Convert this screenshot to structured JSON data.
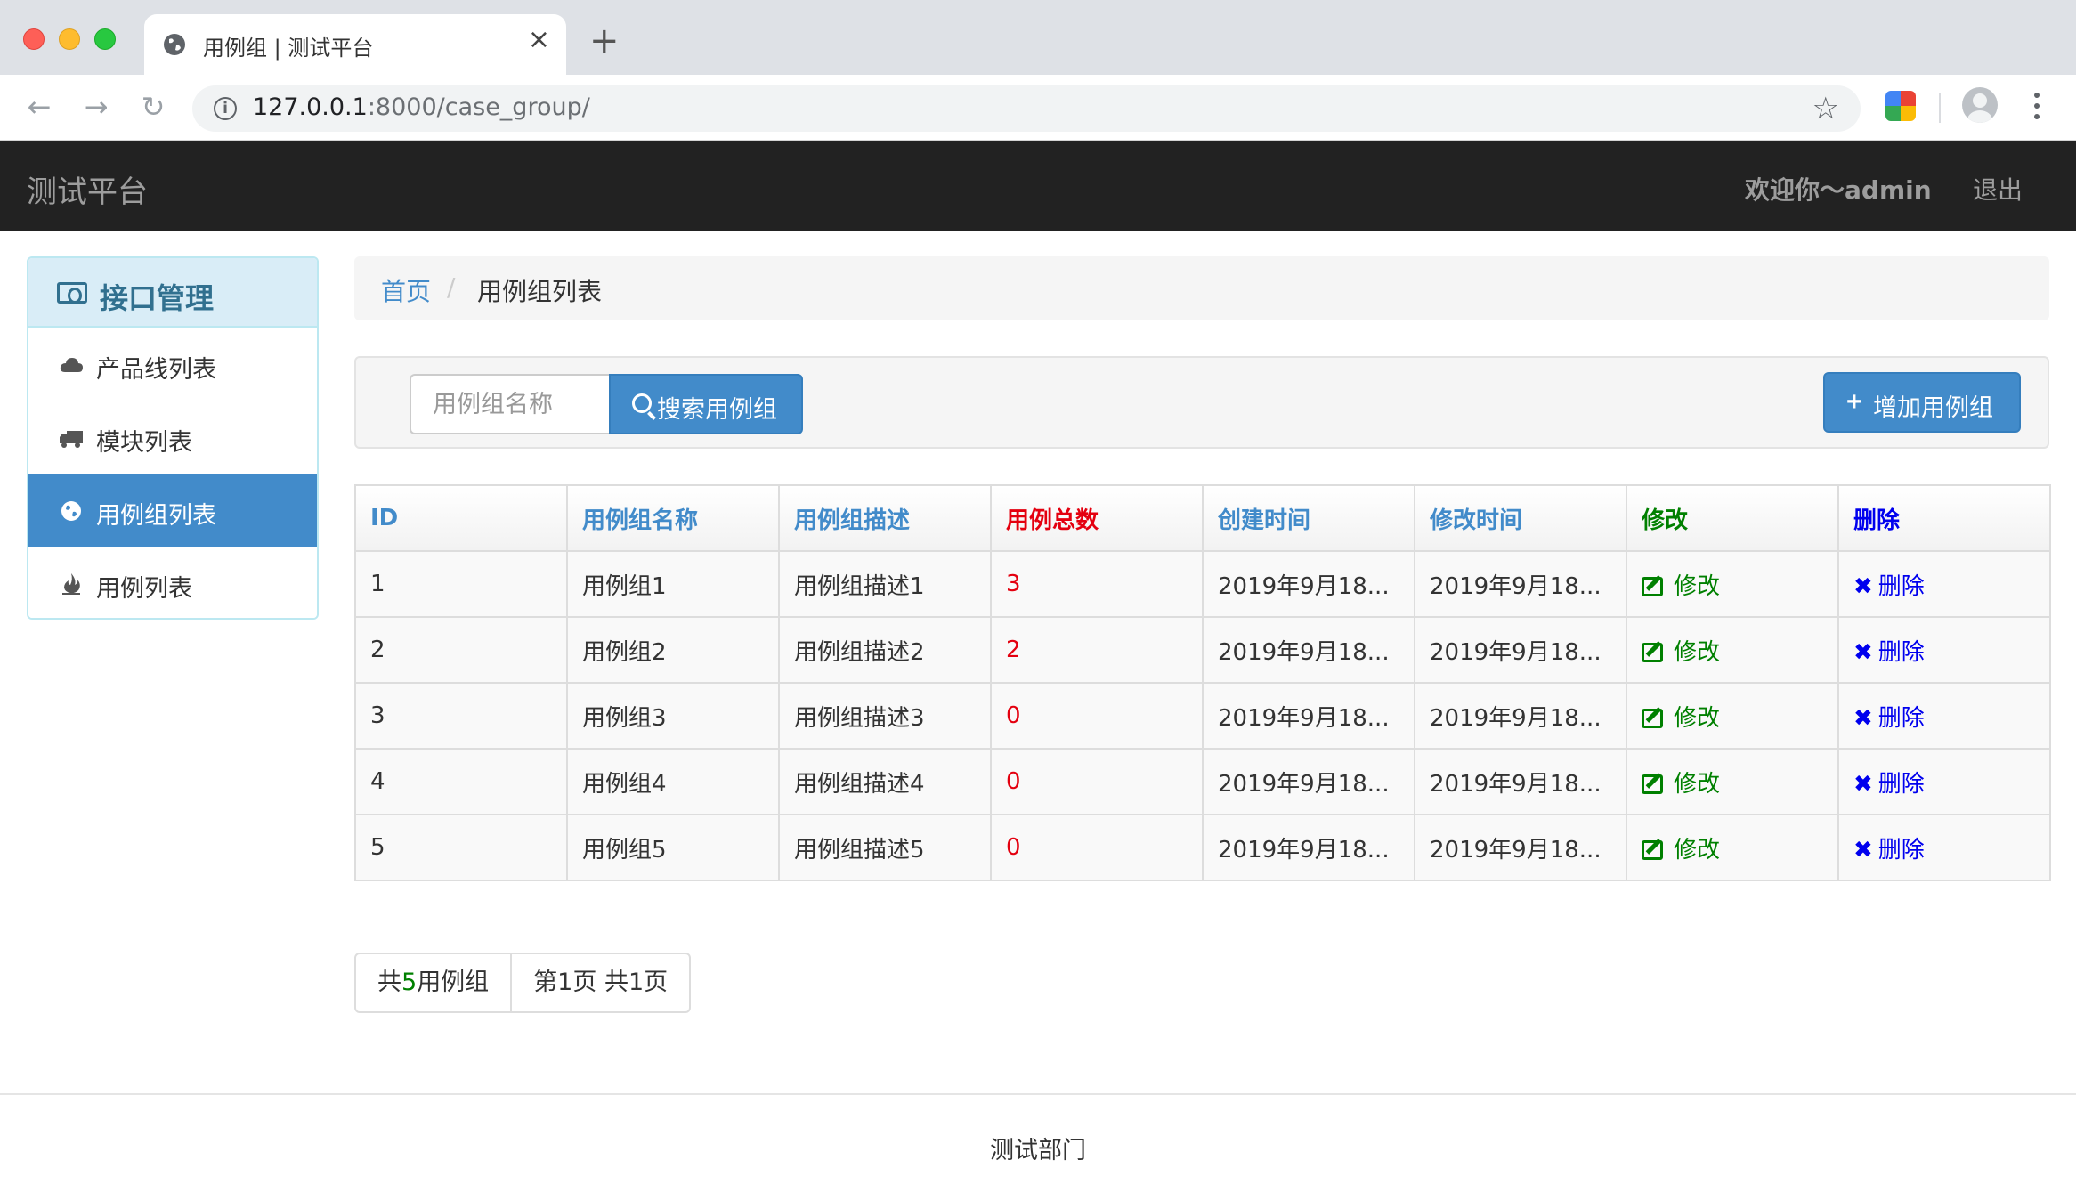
{
  "browser": {
    "tab_title": "用例组 | 测试平台",
    "new_tab": "+",
    "tab_close": "×",
    "url_host": "127.0.0.1",
    "url_rest": ":8000/case_group/"
  },
  "navbar": {
    "brand": "测试平台",
    "welcome": "欢迎你～admin",
    "logout": "退出"
  },
  "sidebar": {
    "heading": "接口管理",
    "items": [
      {
        "label": "产品线列表",
        "icon": "cloud-icon"
      },
      {
        "label": "模块列表",
        "icon": "truck-icon"
      },
      {
        "label": "用例组列表",
        "icon": "globe-icon",
        "active": true
      },
      {
        "label": "用例列表",
        "icon": "fire-icon"
      }
    ]
  },
  "breadcrumb": {
    "home": "首页",
    "separator": "/",
    "current": "用例组列表"
  },
  "search": {
    "placeholder": "用例组名称",
    "button_label": "搜索用例组",
    "add_label": "增加用例组"
  },
  "table": {
    "headers": [
      "ID",
      "用例组名称",
      "用例组描述",
      "用例总数",
      "创建时间",
      "修改时间",
      "修改",
      "删除"
    ],
    "rows": [
      {
        "id": "1",
        "name": "用例组1",
        "desc": "用例组描述1",
        "total": "3",
        "created": "2019年9月18...",
        "modified": "2019年9月18...",
        "edit": "修改",
        "delete": "删除"
      },
      {
        "id": "2",
        "name": "用例组2",
        "desc": "用例组描述2",
        "total": "2",
        "created": "2019年9月18...",
        "modified": "2019年9月18...",
        "edit": "修改",
        "delete": "删除"
      },
      {
        "id": "3",
        "name": "用例组3",
        "desc": "用例组描述3",
        "total": "0",
        "created": "2019年9月18...",
        "modified": "2019年9月18...",
        "edit": "修改",
        "delete": "删除"
      },
      {
        "id": "4",
        "name": "用例组4",
        "desc": "用例组描述4",
        "total": "0",
        "created": "2019年9月18...",
        "modified": "2019年9月18...",
        "edit": "修改",
        "delete": "删除"
      },
      {
        "id": "5",
        "name": "用例组5",
        "desc": "用例组描述5",
        "total": "0",
        "created": "2019年9月18...",
        "modified": "2019年9月18...",
        "edit": "修改",
        "delete": "删除"
      }
    ]
  },
  "pagination": {
    "total_prefix": "共",
    "total_count": "5",
    "total_suffix": "用例组",
    "page_info": "第1页 共1页"
  },
  "footer": {
    "text": "测试部门"
  },
  "colors": {
    "primary": "#428bca",
    "navbar": "#222222",
    "total_red": "#e4000f",
    "edit_green": "#008000",
    "delete_blue": "#0000ee"
  }
}
